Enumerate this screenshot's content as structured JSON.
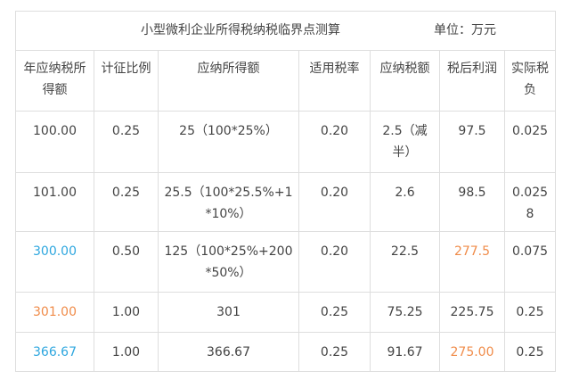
{
  "table": {
    "title": "小型微利企业所得税纳税临界点测算",
    "unit": "单位：万元",
    "headers": [
      "年应纳税所得额",
      "计征比例",
      "应纳所得额",
      "适用税率",
      "应纳税额",
      "税后利润",
      "实际税负"
    ],
    "rows": [
      {
        "income": "100.00",
        "ratio": "0.25",
        "taxable": "25（100*25%）",
        "rate": "0.20",
        "tax": "2.5（减半）",
        "profit": "97.5",
        "burden": "0.025"
      },
      {
        "income": "101.00",
        "ratio": "0.25",
        "taxable": "25.5（100*25.5%+1*10%）",
        "rate": "0.20",
        "tax": "2.6",
        "profit": "98.5",
        "burden": "0.0258"
      },
      {
        "income": "300.00",
        "ratio": "0.50",
        "taxable": "125（100*25%+200*50%）",
        "rate": "0.20",
        "tax": "22.5",
        "profit": "277.5",
        "burden": "0.075"
      },
      {
        "income": "301.00",
        "ratio": "1.00",
        "taxable": "301",
        "rate": "0.25",
        "tax": "75.25",
        "profit": "225.75",
        "burden": "0.25"
      },
      {
        "income": "366.67",
        "ratio": "1.00",
        "taxable": "366.67",
        "rate": "0.25",
        "tax": "91.67",
        "profit": "275.00",
        "burden": "0.25"
      }
    ]
  },
  "colors": {
    "highlight_blue": "#2fa7df",
    "highlight_orange": "#f08c4a",
    "text": "#444444",
    "border": "#dedede"
  }
}
